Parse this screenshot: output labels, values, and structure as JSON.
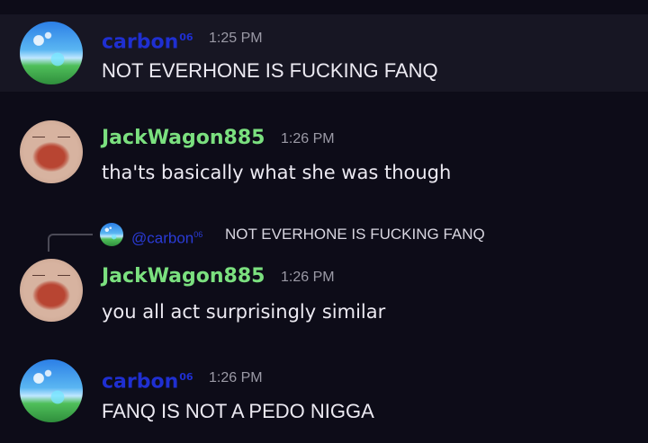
{
  "colors": {
    "background": "#0d0c18",
    "highlight_row": "#171623",
    "carbon_name": "#1f2fd1",
    "jackwagon_name": "#7be07f",
    "timestamp": "#9b9aa6",
    "message_text": "#eceaf2"
  },
  "messages": [
    {
      "author": "carbon",
      "author_tag": "06",
      "time": "1:25 PM",
      "text": "NOT EVERHONE IS FUCKING FANQ",
      "avatar": "sky-landscape-avatar"
    },
    {
      "author": "JackWagon885",
      "time": "1:26 PM",
      "text": "tha'ts basically what she was though",
      "avatar": "pig-face-avatar"
    },
    {
      "reply": {
        "mention": "@carbon",
        "mention_tag": "06",
        "text": "NOT EVERHONE IS FUCKING FANQ"
      },
      "author": "JackWagon885",
      "time": "1:26 PM",
      "text": "you all act surprisingly similar",
      "avatar": "pig-face-avatar"
    },
    {
      "author": "carbon",
      "author_tag": "06",
      "time": "1:26 PM",
      "text": "FANQ IS NOT A PEDO NIGGA",
      "avatar": "sky-landscape-avatar"
    }
  ]
}
